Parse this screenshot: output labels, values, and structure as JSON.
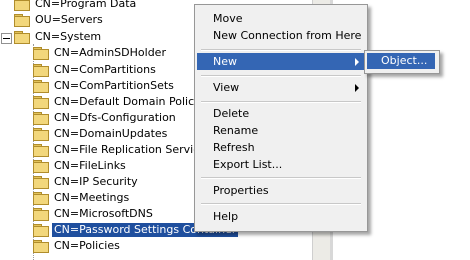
{
  "tree": {
    "items": [
      {
        "label": "CN=Program Data"
      },
      {
        "label": "OU=Servers"
      },
      {
        "label": "CN=System"
      },
      {
        "label": "CN=AdminSDHolder"
      },
      {
        "label": "CN=ComPartitions"
      },
      {
        "label": "CN=ComPartitionSets"
      },
      {
        "label": "CN=Default Domain Policy"
      },
      {
        "label": "CN=Dfs-Configuration"
      },
      {
        "label": "CN=DomainUpdates"
      },
      {
        "label": "CN=File Replication Service"
      },
      {
        "label": "CN=FileLinks"
      },
      {
        "label": "CN=IP Security"
      },
      {
        "label": "CN=Meetings"
      },
      {
        "label": "CN=MicrosoftDNS"
      },
      {
        "label": "CN=Password Settings Container"
      },
      {
        "label": "CN=Policies"
      }
    ],
    "selected": "CN=Password Settings Container"
  },
  "context_menu": {
    "move": "Move",
    "new_connection": "New Connection from Here",
    "new": "New",
    "view": "View",
    "delete": "Delete",
    "rename": "Rename",
    "refresh": "Refresh",
    "export_list": "Export List...",
    "properties": "Properties",
    "help": "Help"
  },
  "submenu": {
    "object": "Object..."
  },
  "colors": {
    "selection": "#1f4f9e",
    "menu_highlight": "#3466b4",
    "folder": "#f2d77c"
  }
}
